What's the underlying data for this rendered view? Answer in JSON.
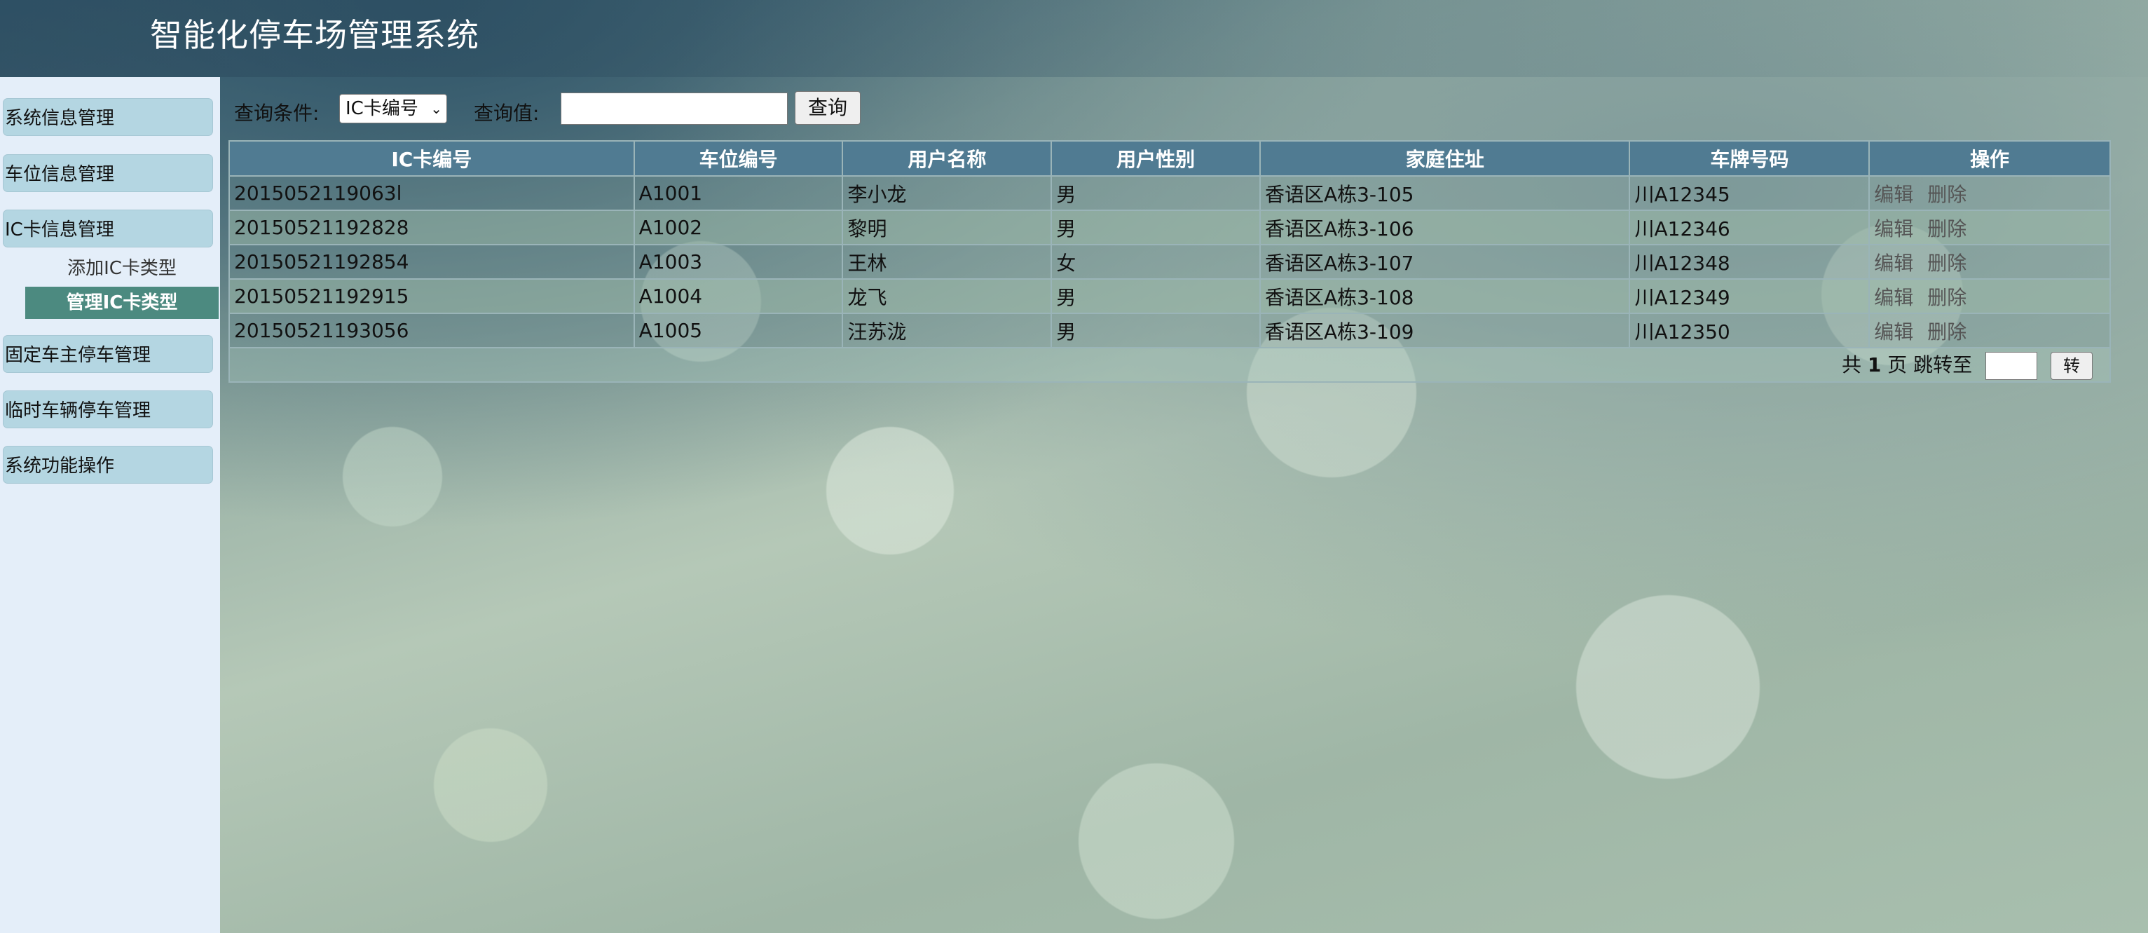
{
  "app": {
    "title": "智能化停车场管理系统"
  },
  "sidebar": {
    "menus": [
      {
        "label": "系统信息管理"
      },
      {
        "label": "车位信息管理"
      },
      {
        "label": "IC卡信息管理"
      },
      {
        "label": "固定车主停车管理"
      },
      {
        "label": "临时车辆停车管理"
      },
      {
        "label": "系统功能操作"
      }
    ],
    "submenu": [
      {
        "label": "添加IC卡类型"
      },
      {
        "label": "管理IC卡类型"
      }
    ]
  },
  "search": {
    "condition_label": "查询条件:",
    "condition_value": "IC卡编号",
    "value_label": "查询值:",
    "query_input_value": "",
    "query_button": "查询"
  },
  "table": {
    "headers": [
      "IC卡编号",
      "车位编号",
      "用户名称",
      "用户性别",
      "家庭住址",
      "车牌号码",
      "操作"
    ],
    "rows": [
      {
        "ic": "2015052119063l",
        "space": "A1001",
        "name": "李小龙",
        "gender": "男",
        "address": "香语区A栋3-105",
        "plate": "川A12345"
      },
      {
        "ic": "20150521192828",
        "space": "A1002",
        "name": "黎明",
        "gender": "男",
        "address": "香语区A栋3-106",
        "plate": "川A12346"
      },
      {
        "ic": "20150521192854",
        "space": "A1003",
        "name": "王林",
        "gender": "女",
        "address": "香语区A栋3-107",
        "plate": "川A12348"
      },
      {
        "ic": "20150521192915",
        "space": "A1004",
        "name": "龙飞",
        "gender": "男",
        "address": "香语区A栋3-108",
        "plate": "川A12349"
      },
      {
        "ic": "20150521193056",
        "space": "A1005",
        "name": "汪苏泷",
        "gender": "男",
        "address": "香语区A栋3-109",
        "plate": "川A12350"
      }
    ],
    "actions": {
      "edit": "编辑",
      "delete": "删除"
    }
  },
  "pager": {
    "prefix": "共",
    "total_pages": "1",
    "suffix": "页 跳转至",
    "go_button": "转"
  }
}
